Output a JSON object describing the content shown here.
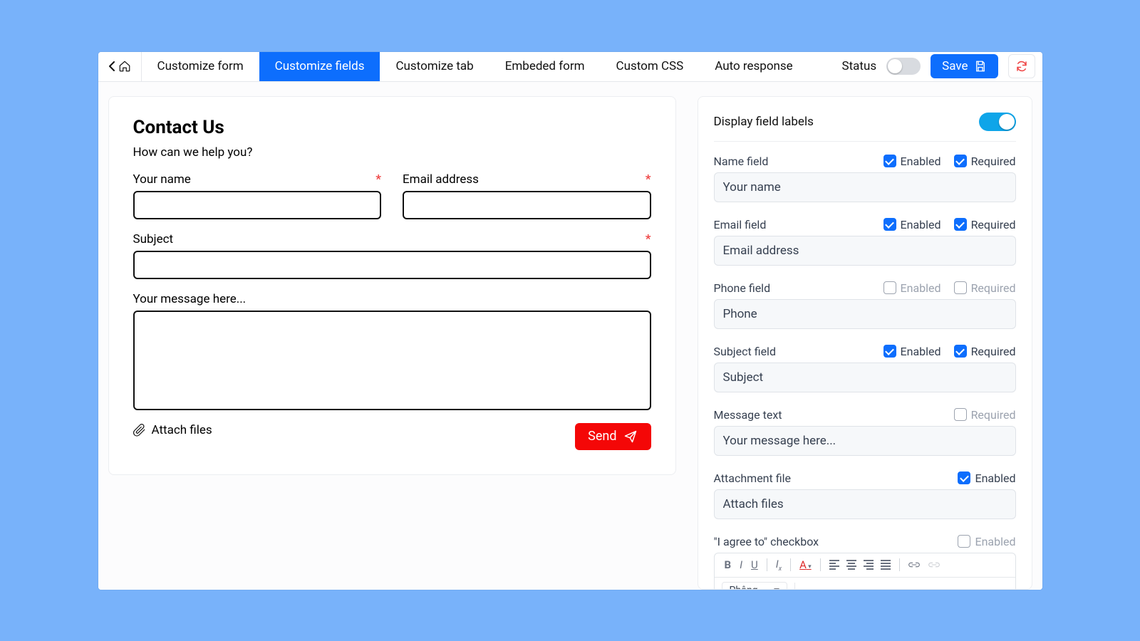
{
  "toolbar": {
    "tabs": [
      "Customize form",
      "Customize fields",
      "Customize tab",
      "Embeded form",
      "Custom CSS",
      "Auto response"
    ],
    "active_index": 1,
    "status_label": "Status",
    "status_on": false,
    "save_label": "Save"
  },
  "preview": {
    "title": "Contact Us",
    "subtitle": "How can we help you?",
    "fields": {
      "name": {
        "label": "Your name",
        "required": true
      },
      "email": {
        "label": "Email address",
        "required": true
      },
      "subject": {
        "label": "Subject",
        "required": true
      },
      "message": {
        "label": "Your message here...",
        "required": false
      }
    },
    "attach_label": "Attach files",
    "send_label": "Send"
  },
  "settings": {
    "display_labels_title": "Display field labels",
    "display_labels_on": true,
    "enabled_word": "Enabled",
    "required_word": "Required",
    "fields": [
      {
        "key": "name",
        "title": "Name field",
        "value": "Your name",
        "enabled": true,
        "enabled_shown": true,
        "required": true,
        "required_shown": true
      },
      {
        "key": "email",
        "title": "Email field",
        "value": "Email address",
        "enabled": true,
        "enabled_shown": true,
        "required": true,
        "required_shown": true
      },
      {
        "key": "phone",
        "title": "Phone field",
        "value": "Phone",
        "enabled": false,
        "enabled_shown": true,
        "required": false,
        "required_shown": true
      },
      {
        "key": "subject",
        "title": "Subject field",
        "value": "Subject",
        "enabled": true,
        "enabled_shown": true,
        "required": true,
        "required_shown": true
      },
      {
        "key": "message",
        "title": "Message text",
        "value": "Your message here...",
        "enabled_shown": false,
        "required": false,
        "required_shown": true
      },
      {
        "key": "attachment",
        "title": "Attachment file",
        "value": "Attach files",
        "enabled": true,
        "enabled_shown": true,
        "required_shown": false
      },
      {
        "key": "agree",
        "title": "\"I agree to\" checkbox",
        "enabled": false,
        "enabled_shown": true,
        "required_shown": false,
        "rte": true
      }
    ],
    "rte_font": "Phông"
  }
}
